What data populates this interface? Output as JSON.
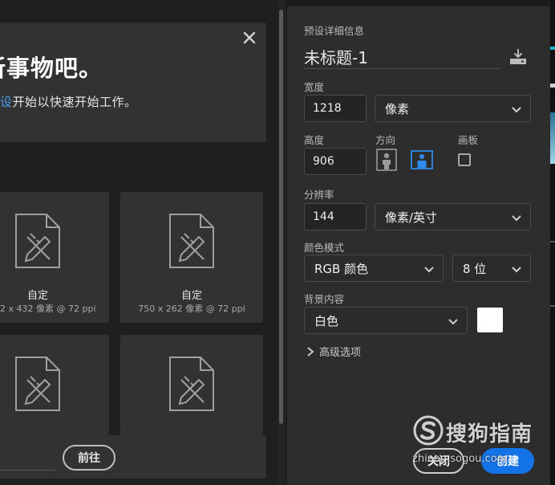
{
  "welcome": {
    "title": "新事物吧。",
    "subtitle_link": "设",
    "subtitle_rest": "开始以快速开始工作。"
  },
  "presets": [
    {
      "name": "自定",
      "size": "2 x 432 像素 @ 72 ppi"
    },
    {
      "name": "自定",
      "size": "750 x 262 像素 @ 72 ppi"
    },
    {
      "name": "",
      "size": ""
    },
    {
      "name": "",
      "size": ""
    }
  ],
  "footer": {
    "goto_label": "前往"
  },
  "details": {
    "section_label": "预设详细信息",
    "doc_name": "未标题-1",
    "width_label": "宽度",
    "width_value": "1218",
    "width_unit": "像素",
    "height_label": "高度",
    "height_value": "906",
    "orientation_label": "方向",
    "artboard_label": "画板",
    "resolution_label": "分辨率",
    "resolution_value": "144",
    "resolution_unit": "像素/英寸",
    "color_mode_label": "颜色模式",
    "color_mode": "RGB 颜色",
    "bit_depth": "8 位",
    "background_label": "背景内容",
    "background_value": "白色",
    "background_color": "#ffffff",
    "advanced_label": "高级选项"
  },
  "actions": {
    "close_label": "关闭",
    "create_label": "创建"
  },
  "watermark": {
    "brand": "搜狗指南",
    "url": "zhinan.sogou.com"
  },
  "colors": {
    "accent": "#1473e6",
    "link": "#4d9ff1",
    "panel": "#2d2d2d",
    "card": "#323232"
  }
}
